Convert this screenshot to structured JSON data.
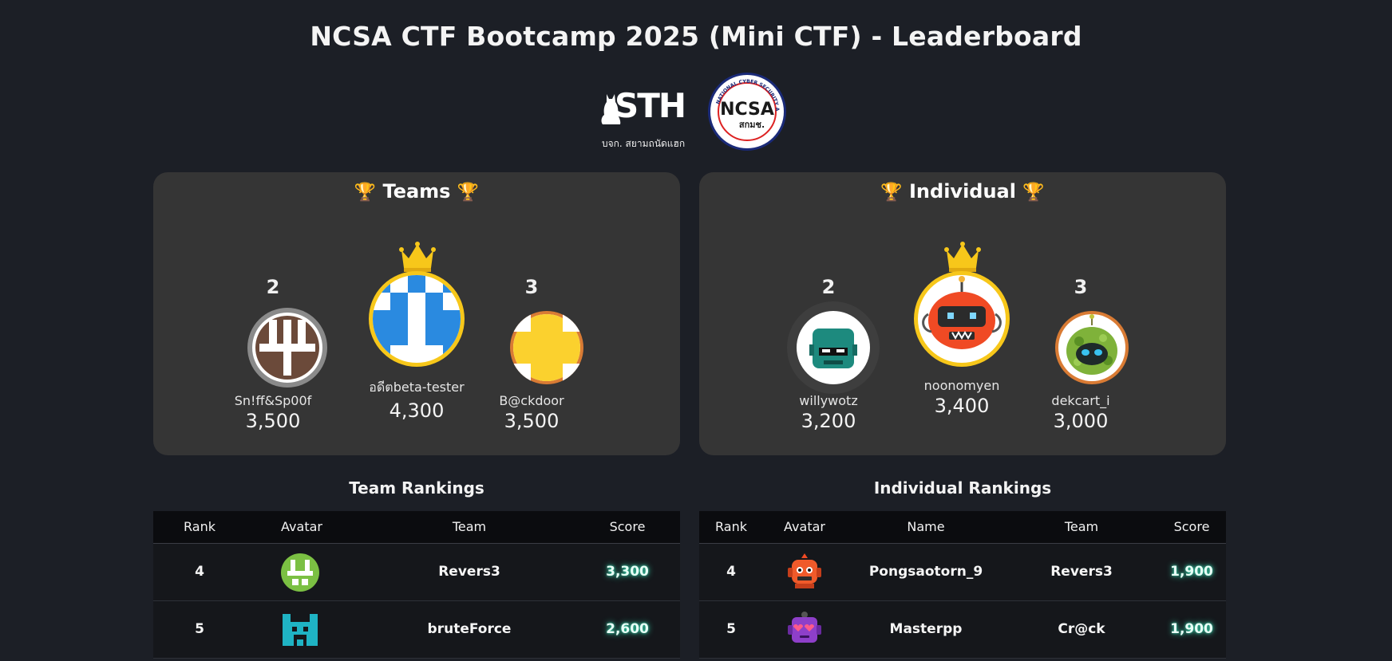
{
  "page": {
    "title": "NCSA CTF Bootcamp 2025 (Mini CTF) - Leaderboard"
  },
  "logos": {
    "sth_text": "STH",
    "sth_subtitle": "บจก. สยามถนัดแฮก",
    "ncsa_text": "NCSA",
    "ncsa_thai": "สกมช.",
    "ncsa_ring_text": "NATIONAL CYBER SECURITY AGENCY"
  },
  "teams_podium": {
    "title": "Teams",
    "trophy_icon": "🏆",
    "first": {
      "name": "อดีตbeta-tester",
      "score": "4,300"
    },
    "second": {
      "rank": "2",
      "name": "Sn!ff&Sp00f",
      "score": "3,500"
    },
    "third": {
      "rank": "3",
      "name": "B@ckdoor",
      "score": "3,500"
    }
  },
  "individual_podium": {
    "title": "Individual",
    "trophy_icon": "🏆",
    "first": {
      "name": "noonomyen",
      "score": "3,400"
    },
    "second": {
      "rank": "2",
      "name": "willywotz",
      "score": "3,200"
    },
    "third": {
      "rank": "3",
      "name": "dekcart_i",
      "score": "3,000"
    }
  },
  "team_rankings": {
    "title": "Team Rankings",
    "columns": [
      "Rank",
      "Avatar",
      "Team",
      "Score"
    ],
    "rows": [
      {
        "rank": "4",
        "team": "Revers3",
        "score": "3,300"
      },
      {
        "rank": "5",
        "team": "bruteForce",
        "score": "2,600"
      }
    ]
  },
  "individual_rankings": {
    "title": "Individual Rankings",
    "columns": [
      "Rank",
      "Avatar",
      "Name",
      "Team",
      "Score"
    ],
    "rows": [
      {
        "rank": "4",
        "name": "Pongsaotorn_9",
        "team": "Revers3",
        "score": "1,900"
      },
      {
        "rank": "5",
        "name": "Masterpp",
        "team": "Cr@ck",
        "score": "1,900"
      }
    ]
  },
  "colors": {
    "background": "#1c1f26",
    "panel": "#353535",
    "gold": "#f7c71a",
    "silver": "#8a8a8a",
    "bronze": "#d97b34",
    "score_glow": "#3de0b8"
  }
}
